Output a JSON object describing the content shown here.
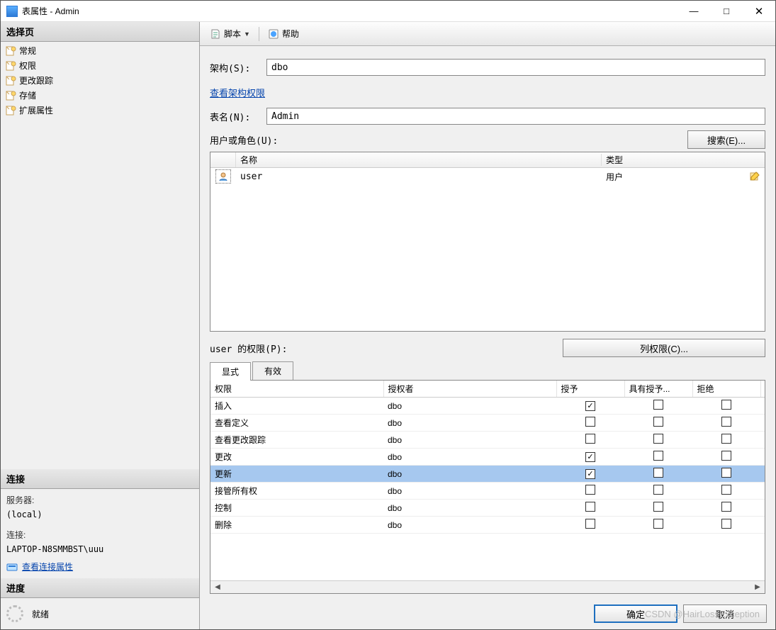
{
  "window": {
    "title": "表属性 - Admin"
  },
  "win_controls": {
    "min": "—",
    "max": "□",
    "close": "✕"
  },
  "sidebar": {
    "select_page": "选择页",
    "items": [
      "常规",
      "权限",
      "更改跟踪",
      "存储",
      "扩展属性"
    ],
    "connection_header": "连接",
    "server_label": "服务器:",
    "server_value": "(local)",
    "conn_label": "连接:",
    "conn_value": "LAPTOP-N8SMMBST\\uuu",
    "view_conn_props": "查看连接属性",
    "progress_header": "进度",
    "progress_status": "就绪"
  },
  "toolbar": {
    "script": "脚本",
    "help": "帮助"
  },
  "form": {
    "schema_label": "架构(S):",
    "schema_value": "dbo",
    "schema_link": "查看架构权限",
    "table_label": "表名(N):",
    "table_value": "Admin"
  },
  "users": {
    "label": "用户或角色(U):",
    "search_btn": "搜索(E)...",
    "col_name": "名称",
    "col_type": "类型",
    "rows": [
      {
        "name": "user",
        "type": "用户"
      }
    ]
  },
  "perms": {
    "label": "user 的权限(P):",
    "col_perm_btn": "列权限(C)...",
    "tabs": [
      "显式",
      "有效"
    ],
    "cols": {
      "perm": "权限",
      "grantor": "授权者",
      "grant": "授予",
      "with_grant": "具有授予...",
      "deny": "拒绝"
    },
    "rows": [
      {
        "perm": "插入",
        "grantor": "dbo",
        "grant": true,
        "with_grant": false,
        "deny": false,
        "selected": false
      },
      {
        "perm": "查看定义",
        "grantor": "dbo",
        "grant": false,
        "with_grant": false,
        "deny": false,
        "selected": false
      },
      {
        "perm": "查看更改跟踪",
        "grantor": "dbo",
        "grant": false,
        "with_grant": false,
        "deny": false,
        "selected": false
      },
      {
        "perm": "更改",
        "grantor": "dbo",
        "grant": true,
        "with_grant": false,
        "deny": false,
        "selected": false
      },
      {
        "perm": "更新",
        "grantor": "dbo",
        "grant": true,
        "with_grant": false,
        "deny": false,
        "selected": true
      },
      {
        "perm": "接管所有权",
        "grantor": "dbo",
        "grant": false,
        "with_grant": false,
        "deny": false,
        "selected": false
      },
      {
        "perm": "控制",
        "grantor": "dbo",
        "grant": false,
        "with_grant": false,
        "deny": false,
        "selected": false
      },
      {
        "perm": "删除",
        "grantor": "dbo",
        "grant": false,
        "with_grant": false,
        "deny": false,
        "selected": false
      }
    ]
  },
  "footer": {
    "ok": "确定",
    "cancel": "取消"
  },
  "watermark": "CSDN @HairLossException"
}
